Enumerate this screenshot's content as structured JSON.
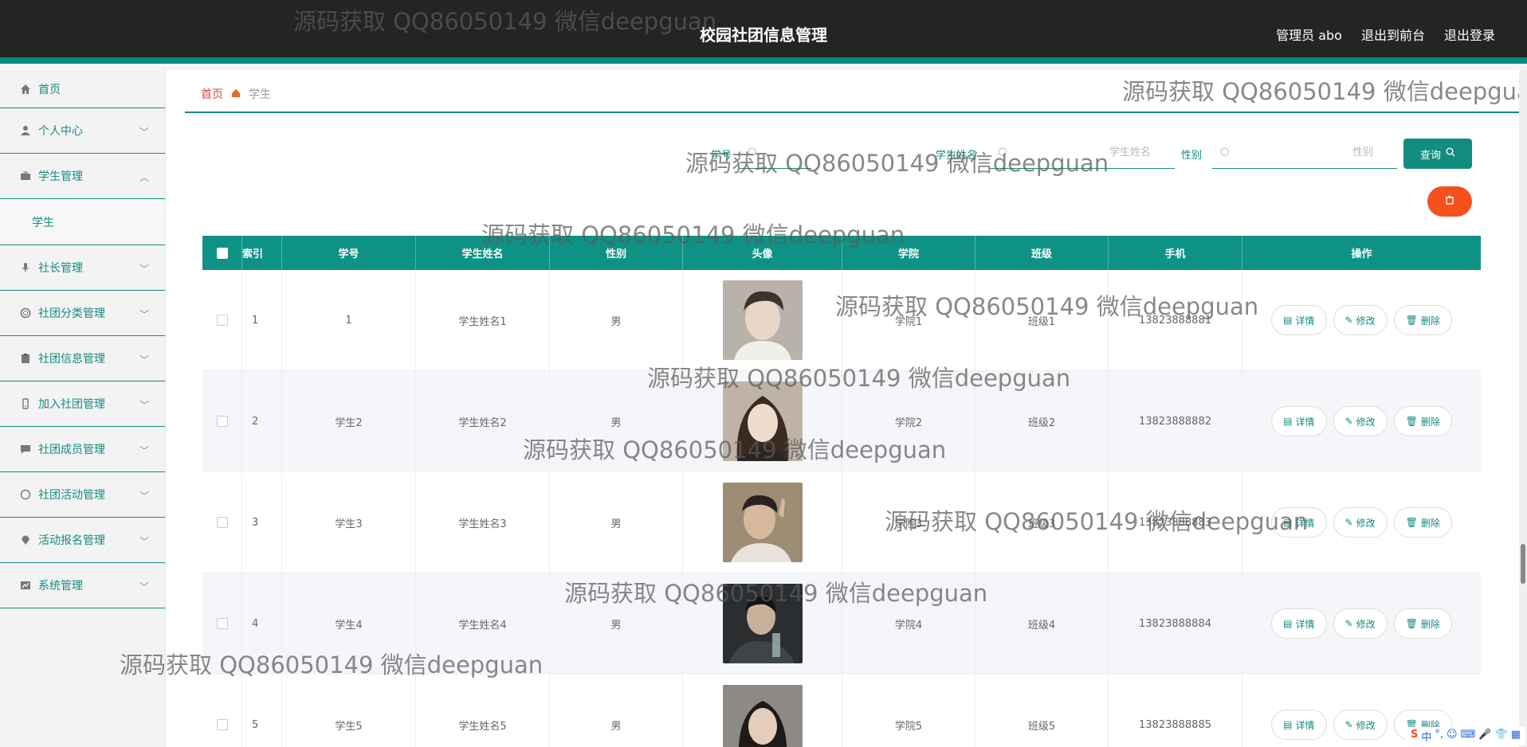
{
  "header": {
    "title": "校园社团信息管理",
    "admin": "管理员 abo",
    "exit_front": "退出到前台",
    "logout": "退出登录"
  },
  "sidebar": {
    "items": [
      {
        "label": "首页",
        "icon": "home-icon"
      },
      {
        "label": "个人中心",
        "icon": "user-icon"
      },
      {
        "label": "学生管理",
        "icon": "briefcase-icon",
        "expanded": true
      },
      {
        "label": "社长管理",
        "icon": "mic-icon"
      },
      {
        "label": "社团分类管理",
        "icon": "ring-icon"
      },
      {
        "label": "社团信息管理",
        "icon": "clipboard-icon"
      },
      {
        "label": "加入社团管理",
        "icon": "badge-icon"
      },
      {
        "label": "社团成员管理",
        "icon": "chat-icon"
      },
      {
        "label": "社团活动管理",
        "icon": "compass-icon"
      },
      {
        "label": "活动报名管理",
        "icon": "pin-icon"
      },
      {
        "label": "系统管理",
        "icon": "chart-icon"
      }
    ],
    "submenu_student": "学生"
  },
  "breadcrumb": {
    "home": "首页",
    "current": "学生"
  },
  "search": {
    "no_label": "学号",
    "name_label": "学生姓名",
    "name_placeholder": "学生姓名",
    "sex_label": "性别",
    "sex_placeholder": "性别",
    "query_label": "查询"
  },
  "table": {
    "headers": [
      "索引",
      "学号",
      "学生姓名",
      "性别",
      "头像",
      "学院",
      "班级",
      "手机",
      "操作"
    ],
    "rows": [
      {
        "index": "1",
        "no": "1",
        "name": "学生姓名1",
        "sex": "男",
        "college": "学院1",
        "class": "班级1",
        "phone": "13823888881"
      },
      {
        "index": "2",
        "no": "学生2",
        "name": "学生姓名2",
        "sex": "男",
        "college": "学院2",
        "class": "班级2",
        "phone": "13823888882"
      },
      {
        "index": "3",
        "no": "学生3",
        "name": "学生姓名3",
        "sex": "男",
        "college": "学院3",
        "class": "班级3",
        "phone": "13823888883"
      },
      {
        "index": "4",
        "no": "学生4",
        "name": "学生姓名4",
        "sex": "男",
        "college": "学院4",
        "class": "班级4",
        "phone": "13823888884"
      },
      {
        "index": "5",
        "no": "学生5",
        "name": "学生姓名5",
        "sex": "男",
        "college": "学院5",
        "class": "班级5",
        "phone": "13823888885"
      }
    ],
    "op_detail": "详情",
    "op_edit": "修改",
    "op_delete": "删除"
  },
  "watermark": "源码获取 QQ86050149 微信deepguan",
  "ime": {
    "lang": "中"
  },
  "colors": {
    "accent": "#138c80",
    "header_bg": "#242424",
    "delete": "#f4511e"
  }
}
